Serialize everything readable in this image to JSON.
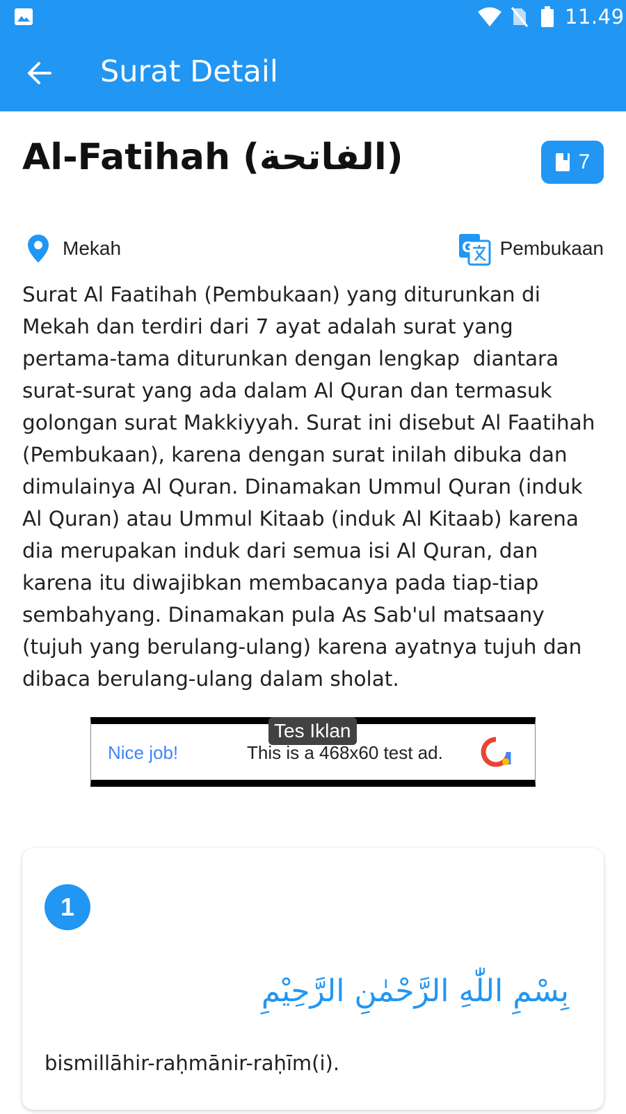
{
  "status_bar": {
    "time": "11.49",
    "icons": [
      "image-icon",
      "wifi-icon",
      "no-sim-icon",
      "battery-icon"
    ]
  },
  "app_bar": {
    "title": "Surat Detail",
    "back_icon": "arrow-back-icon"
  },
  "surat": {
    "name": "Al-Fatihah (الفاتحة)",
    "ayat_count": "7",
    "place": "Mekah",
    "meaning": "Pembukaan",
    "description": "Surat Al Faatihah (Pembukaan) yang diturunkan di Mekah dan terdiri dari 7 ayat adalah surat yang pertama-tama diturunkan dengan lengkap  diantara surat-surat yang ada dalam Al Quran dan termasuk golongan surat Makkiyyah. Surat ini disebut Al Faatihah (Pembukaan), karena dengan surat inilah dibuka dan dimulainya Al Quran. Dinamakan Ummul Quran (induk Al Quran) atau Ummul Kitaab (induk Al Kitaab) karena dia merupakan induk dari semua isi Al Quran, dan karena itu diwajibkan membacanya pada tiap-tiap sembahyang. Dinamakan pula As Sab'ul matsaany (tujuh yang berulang-ulang) karena ayatnya tujuh dan dibaca berulang-ulang dalam sholat."
  },
  "ad": {
    "tag": "Tes Iklan",
    "headline": "Nice job!",
    "text": "This is a 468x60 test ad."
  },
  "ayat_list": [
    {
      "number": "1",
      "arabic": "بِسْمِ اللّٰهِ الرَّحْمٰنِ الرَّحِيْمِ",
      "latin": "bismillāhir-raḥmānir-raḥīm(i)."
    }
  ],
  "colors": {
    "primary": "#2196f3",
    "ad_headline": "#4285f4"
  }
}
